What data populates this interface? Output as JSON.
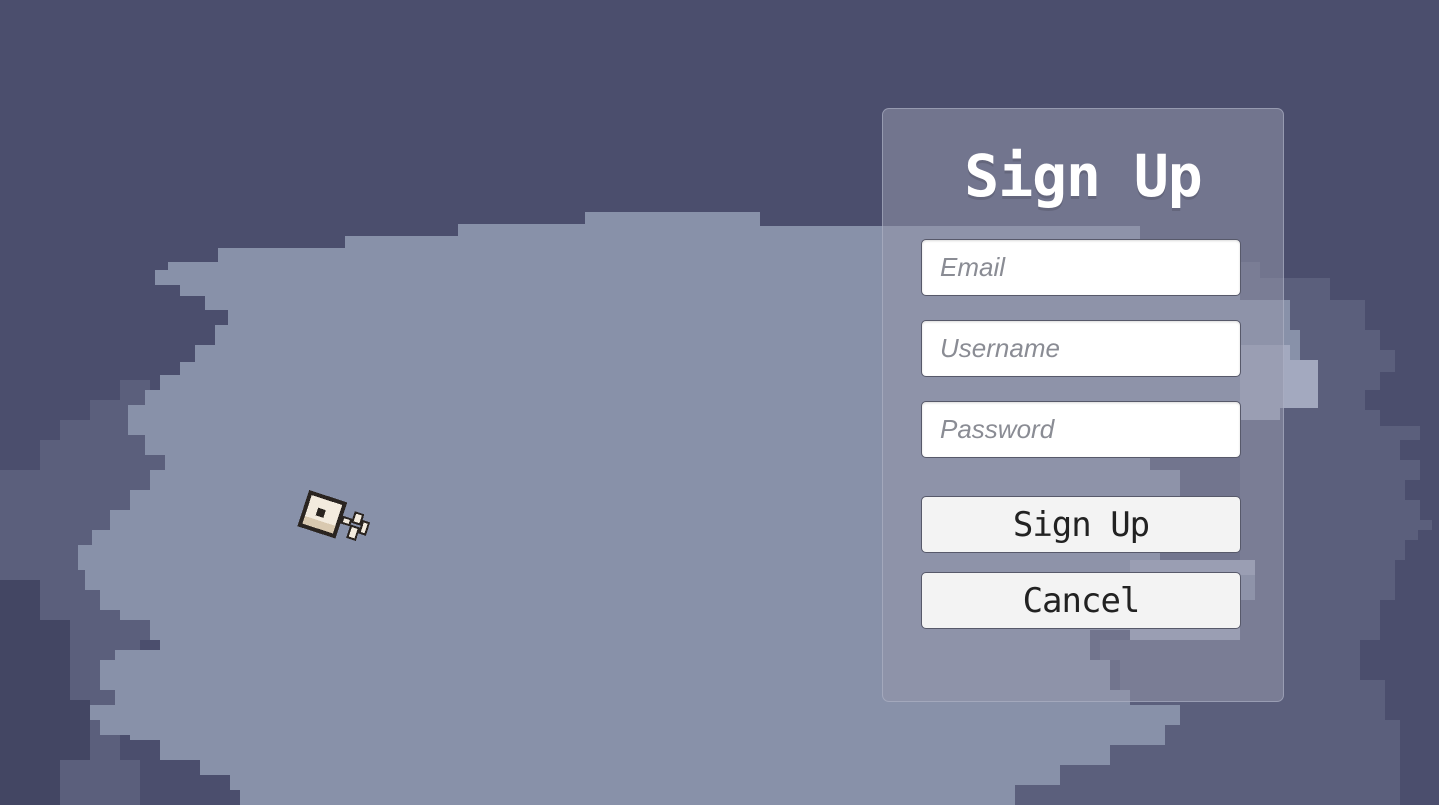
{
  "scene": {
    "colors": {
      "sky": "#4b4e6d",
      "mid": "#5b5f7c",
      "cloud": "#8891a9",
      "highlight": "#a3a9bf"
    },
    "character_icon": "pixel-dog-icon"
  },
  "signup_form": {
    "title": "Sign Up",
    "email": {
      "placeholder": "Email",
      "value": ""
    },
    "username": {
      "placeholder": "Username",
      "value": ""
    },
    "password": {
      "placeholder": "Password",
      "value": ""
    },
    "submit_label": "Sign Up",
    "cancel_label": "Cancel"
  }
}
